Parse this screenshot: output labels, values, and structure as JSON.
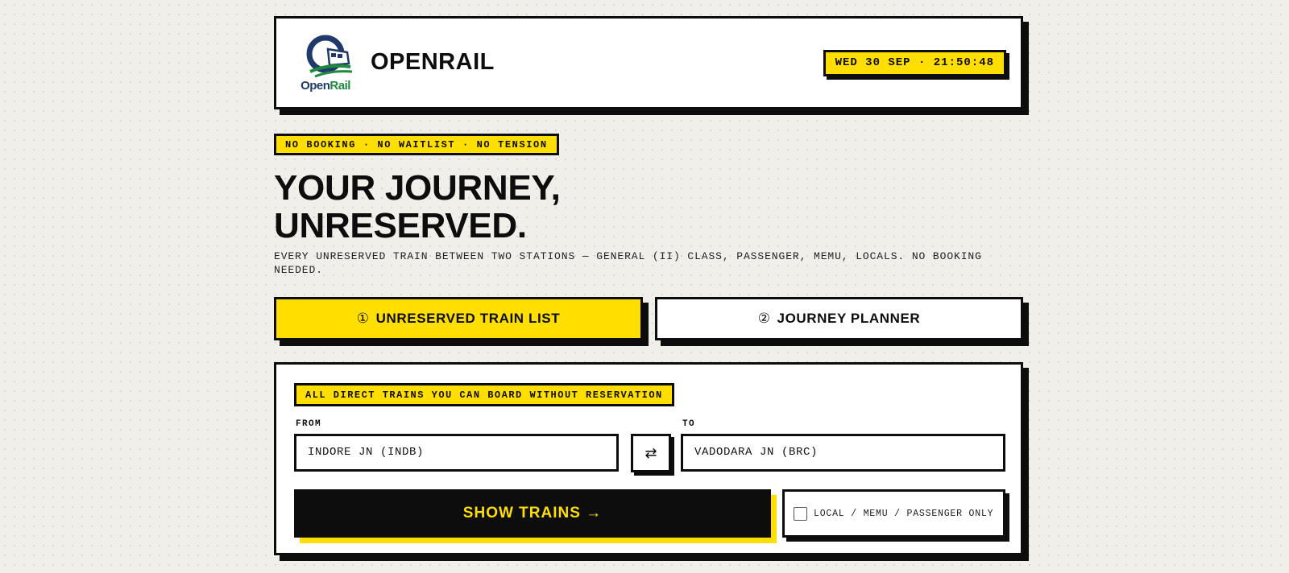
{
  "header": {
    "logo_text_open": "Open",
    "logo_text_rail": "Rail",
    "brand": "OPENRAIL",
    "clock": "WED 30 SEP · 21:50:48"
  },
  "tagline": "NO BOOKING · NO WAITLIST · NO TENSION",
  "hero": {
    "line1": "YOUR JOURNEY,",
    "line2": "UNRESERVED.",
    "subtitle": "EVERY UNRESERVED TRAIN BETWEEN TWO STATIONS — GENERAL (II) CLASS, PASSENGER, MEMU, LOCALS. NO BOOKING NEEDED."
  },
  "tabs": [
    {
      "num": "①",
      "label": "UNRESERVED TRAIN LIST",
      "active": true
    },
    {
      "num": "②",
      "label": "JOURNEY PLANNER",
      "active": false
    }
  ],
  "search": {
    "badge": "ALL DIRECT TRAINS YOU CAN BOARD WITHOUT RESERVATION",
    "from_label": "FROM",
    "from_value": "INDORE JN (INDB)",
    "to_label": "TO",
    "to_value": "VADODARA JN (BRC)",
    "swap_symbol": "⇄",
    "submit_label": "SHOW TRAINS →",
    "filter_label": "LOCAL / MEMU / PASSENGER ONLY",
    "filter_checked": false
  },
  "colors": {
    "accent": "#ffde00",
    "ink": "#0d0d0d",
    "background": "#f1efe9",
    "logo_blue": "#1f3a6b",
    "logo_green": "#1f8a3d"
  },
  "icons": {
    "logo": "openrail-train-logo-icon",
    "swap": "swap-arrows-icon",
    "checkbox": "checkbox-icon"
  }
}
